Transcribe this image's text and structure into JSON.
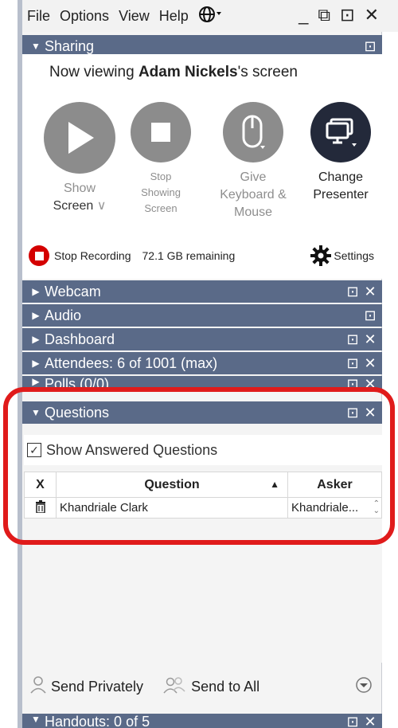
{
  "menubar": {
    "items": [
      "File",
      "Options",
      "View",
      "Help"
    ],
    "globe_icon": "globe-icon",
    "window_controls": [
      "_",
      "⧉",
      "⊡",
      "✕"
    ]
  },
  "sharing": {
    "header": "Sharing",
    "now_viewing_prefix": "Now viewing ",
    "presenter": "Adam Nickels",
    "now_viewing_suffix": "'s screen",
    "controls": {
      "show_screen": {
        "line1": "Show",
        "line2": "Screen"
      },
      "stop_showing": {
        "line1": "Stop",
        "line2": "Showing",
        "line3": "Screen"
      },
      "give_kb_mouse": {
        "line1": "Give",
        "line2": "Keyboard &",
        "line3": "Mouse"
      },
      "change_presenter": {
        "line1": "Change",
        "line2": "Presenter"
      }
    }
  },
  "recording": {
    "stop_label": "Stop Recording",
    "remaining": "72.1 GB remaining",
    "settings_label": "Settings"
  },
  "panels": {
    "webcam": "Webcam",
    "audio": "Audio",
    "dashboard": "Dashboard",
    "attendees": "Attendees:  6 of 1001 (max)",
    "polls": "Polls (0/0)",
    "questions": "Questions",
    "handouts": "Handouts: 0 of 5"
  },
  "questions": {
    "show_answered": "Show Answered Questions",
    "columns": {
      "x": "X",
      "question": "Question",
      "asker": "Asker"
    },
    "rows": [
      {
        "question": "Khandriale Clark",
        "asker": "Khandriale..."
      }
    ]
  },
  "send": {
    "privately": "Send Privately",
    "to_all": "Send to All"
  },
  "colors": {
    "header": "#5a6a88",
    "record": "#d40000",
    "highlight": "#e01b1b",
    "presenter_circle": "#23293a",
    "disabled_circle": "#8c8c8c"
  }
}
